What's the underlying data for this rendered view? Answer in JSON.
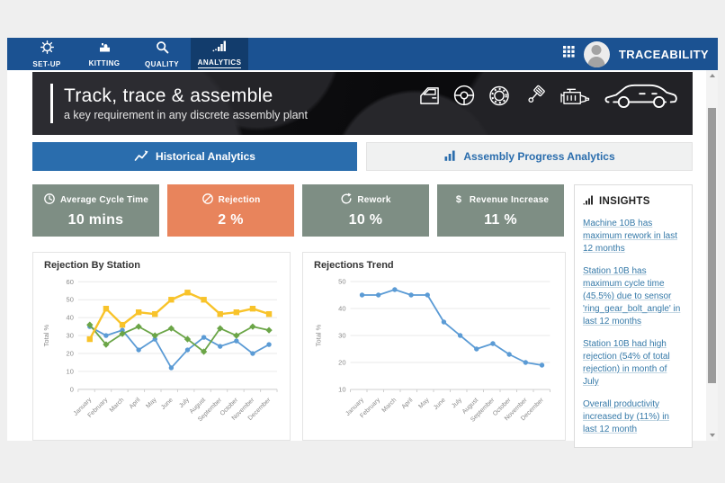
{
  "nav": {
    "brand": "TRACEABILITY",
    "tabs": [
      {
        "label": "SET-UP",
        "icon": "gear-icon",
        "active": false
      },
      {
        "label": "KITTING",
        "icon": "kitting-icon",
        "active": false
      },
      {
        "label": "QUALITY",
        "icon": "magnifier-icon",
        "active": false
      },
      {
        "label": "ANALYTICS",
        "icon": "bar-chart-icon",
        "active": true
      }
    ],
    "colors": {
      "bar": "#1b5292",
      "active_tab": "#123c6c"
    }
  },
  "hero": {
    "title": "Track, trace & assemble",
    "subtitle": "a key requirement in any discrete assembly plant",
    "icons": [
      "car-door-icon",
      "steering-wheel-icon",
      "tire-icon",
      "piston-icon",
      "engine-icon",
      "car-icon"
    ]
  },
  "view_tabs": [
    {
      "label": "Historical Analytics",
      "icon": "line-chart-icon",
      "active": true
    },
    {
      "label": "Assembly Progress Analytics",
      "icon": "bar-chart-icon",
      "active": false
    }
  ],
  "kpis": [
    {
      "label": "Average Cycle Time",
      "value": "10 mins",
      "icon": "clock-icon",
      "color": "#7e8e84"
    },
    {
      "label": "Rejection",
      "value": "2 %",
      "icon": "ban-icon",
      "color": "#e8845c"
    },
    {
      "label": "Rework",
      "value": "10 %",
      "icon": "rework-icon",
      "color": "#7e8e84"
    },
    {
      "label": "Revenue Increase",
      "value": "11 %",
      "icon": "dollar-icon",
      "color": "#7e8e84"
    }
  ],
  "insights": {
    "title": "INSIGHTS",
    "items": [
      "Machine 10B has maximum rework in last 12 months",
      "Station 10B has maximum cycle time (45.5%) due to sensor 'ring_gear_bolt_angle' in last 12 months",
      "Station 10B had high rejection (54% of total rejection) in month of July",
      "Overall productivity increased by (11%) in last 12 month"
    ],
    "link_color": "#3579a8"
  },
  "chart_data": [
    {
      "type": "line",
      "title": "Rejection By Station",
      "xlabel": "",
      "ylabel": "Total %",
      "ylim": [
        0,
        60
      ],
      "yticks": [
        0,
        10,
        20,
        30,
        40,
        50,
        60
      ],
      "grid": true,
      "legend": "none",
      "categories": [
        "January",
        "February",
        "March",
        "April",
        "May",
        "June",
        "July",
        "August",
        "September",
        "October",
        "November",
        "December"
      ],
      "series": [
        {
          "name": "station-blue",
          "color": "#5b9bd5",
          "marker": "circle",
          "values": [
            35,
            30,
            33,
            22,
            28,
            12,
            22,
            29,
            24,
            27,
            20,
            25
          ]
        },
        {
          "name": "station-green",
          "color": "#6ba547",
          "marker": "diamond",
          "values": [
            36,
            25,
            31,
            35,
            30,
            34,
            28,
            21,
            34,
            30,
            35,
            33
          ]
        },
        {
          "name": "station-yellow",
          "color": "#f8c32a",
          "marker": "square",
          "values": [
            28,
            45,
            36,
            43,
            42,
            50,
            54,
            50,
            42,
            43,
            45,
            42
          ]
        }
      ]
    },
    {
      "type": "line",
      "title": "Rejections Trend",
      "xlabel": "",
      "ylabel": "Total %",
      "ylim": [
        10,
        50
      ],
      "yticks": [
        10,
        20,
        30,
        40,
        50
      ],
      "grid": true,
      "legend": "none",
      "categories": [
        "January",
        "February",
        "March",
        "April",
        "May",
        "June",
        "July",
        "August",
        "September",
        "October",
        "November",
        "December"
      ],
      "series": [
        {
          "name": "rejections",
          "color": "#5b9bd5",
          "marker": "circle",
          "values": [
            45,
            45,
            47,
            45,
            45,
            35,
            30,
            25,
            27,
            23,
            20,
            19
          ]
        }
      ]
    }
  ]
}
